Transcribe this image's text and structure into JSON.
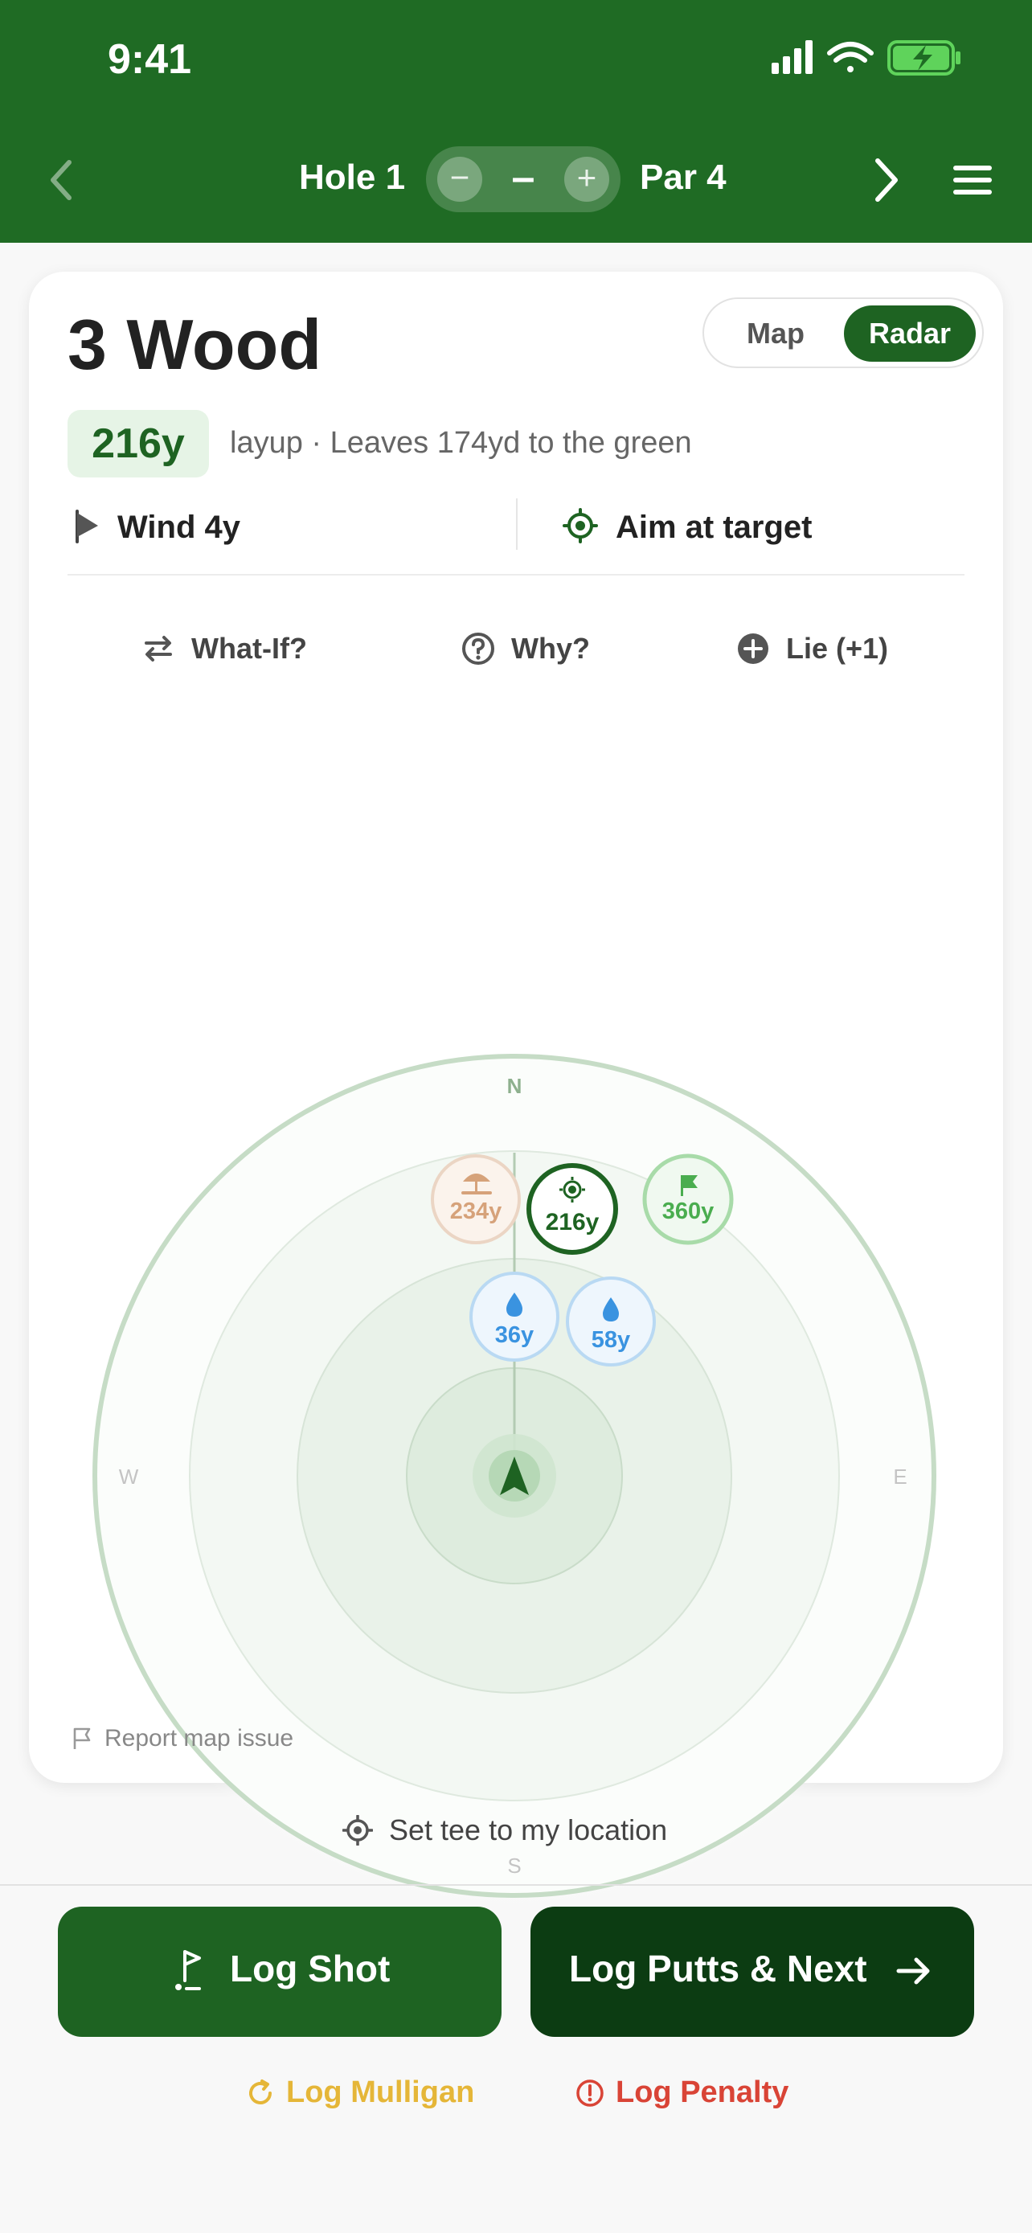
{
  "status": {
    "time": "9:41"
  },
  "nav": {
    "hole_label": "Hole 1",
    "stepper_minus": "−",
    "stepper_value": "–",
    "stepper_plus": "+",
    "par_label": "Par 4"
  },
  "card": {
    "club": "3 Wood",
    "view_toggle": {
      "map": "Map",
      "radar": "Radar",
      "selected": "Radar"
    },
    "distance": "216y",
    "layup_text": "layup · Leaves 174yd to the green",
    "wind": "Wind 4y",
    "aim": "Aim at target",
    "actions": {
      "what_if": "What-If?",
      "why": "Why?",
      "lie": "Lie (+1)"
    },
    "report": "Report map issue"
  },
  "radar": {
    "compass": {
      "n": "N",
      "e": "E",
      "s": "S",
      "w": "W"
    },
    "markers": {
      "bunker": "234y",
      "target": "216y",
      "flag": "360y",
      "water_left": "36y",
      "water_right": "58y"
    },
    "colors": {
      "target": "#1e6322",
      "bunker": "#d6a27a",
      "flag": "#4aad4f",
      "water": "#3a93e0"
    }
  },
  "footer": {
    "set_tee": "Set tee to my location",
    "log_shot": "Log Shot",
    "log_putts": "Log Putts & Next",
    "mulligan": "Log Mulligan",
    "penalty": "Log Penalty"
  }
}
